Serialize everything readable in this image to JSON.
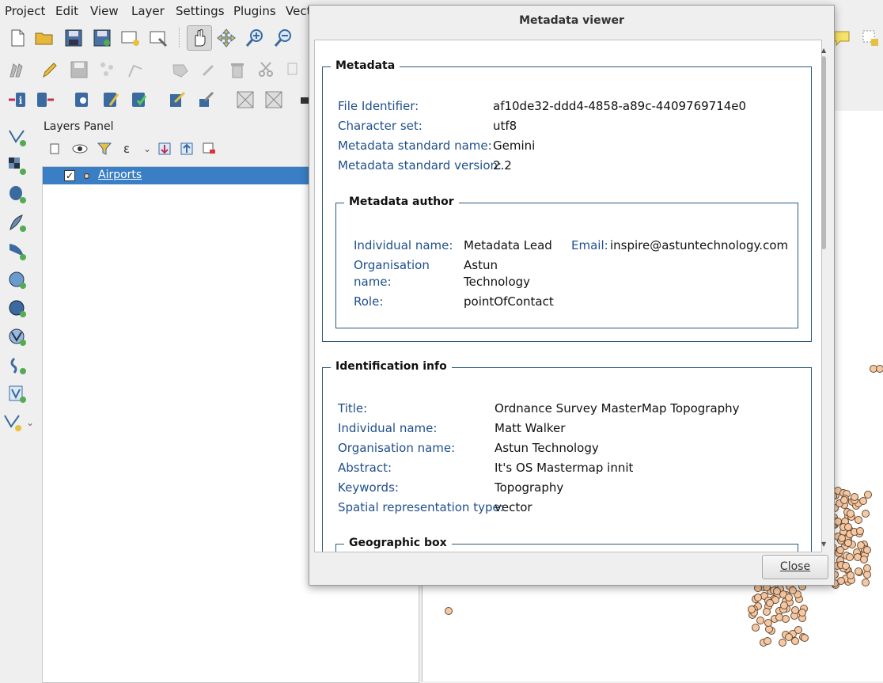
{
  "menu": [
    "Project",
    "Edit",
    "View",
    "Layer",
    "Settings",
    "Plugins",
    "Vect"
  ],
  "layers_panel": {
    "title": "Layers Panel",
    "layers": [
      {
        "name": "Airports",
        "checked": true
      }
    ]
  },
  "dialog": {
    "title": "Metadata viewer",
    "metadata": {
      "legend": "Metadata",
      "fields": [
        {
          "key": "File Identifier:",
          "value": "af10de32-ddd4-4858-a89c-4409769714e0"
        },
        {
          "key": "Character set:",
          "value": "utf8"
        },
        {
          "key": "Metadata standard name:",
          "value": "Gemini"
        },
        {
          "key": "Metadata standard version:",
          "value": "2.2"
        }
      ],
      "author": {
        "legend": "Metadata author",
        "individual_name_label": "Individual name:",
        "individual_name": "Metadata Lead",
        "email_label": "Email:",
        "email": "inspire@astuntechnology.com",
        "organisation_label_1": "Organisation",
        "organisation_label_2": "name:",
        "organisation_1": "Astun",
        "organisation_2": "Technology",
        "role_label": "Role:",
        "role": "pointOfContact"
      }
    },
    "identification": {
      "legend": "Identification info",
      "fields": [
        {
          "key": "Title:",
          "value": "Ordnance Survey MasterMap Topography"
        },
        {
          "key": "Individual name:",
          "value": "Matt Walker"
        },
        {
          "key": "Organisation name:",
          "value": "Astun Technology"
        },
        {
          "key": "Abstract:",
          "value": "It's OS Mastermap innit"
        },
        {
          "key": "Keywords:",
          "value": "Topography"
        },
        {
          "key": "Spatial representation type:",
          "value": "vector"
        }
      ],
      "geo_box_legend": "Geographic box"
    },
    "close_label": "Close"
  },
  "colors": {
    "accent": "#3a7fc5",
    "field_label": "#1f4f8c",
    "frame": "#2c5a7a",
    "point_fill": "#f4c8a4"
  }
}
